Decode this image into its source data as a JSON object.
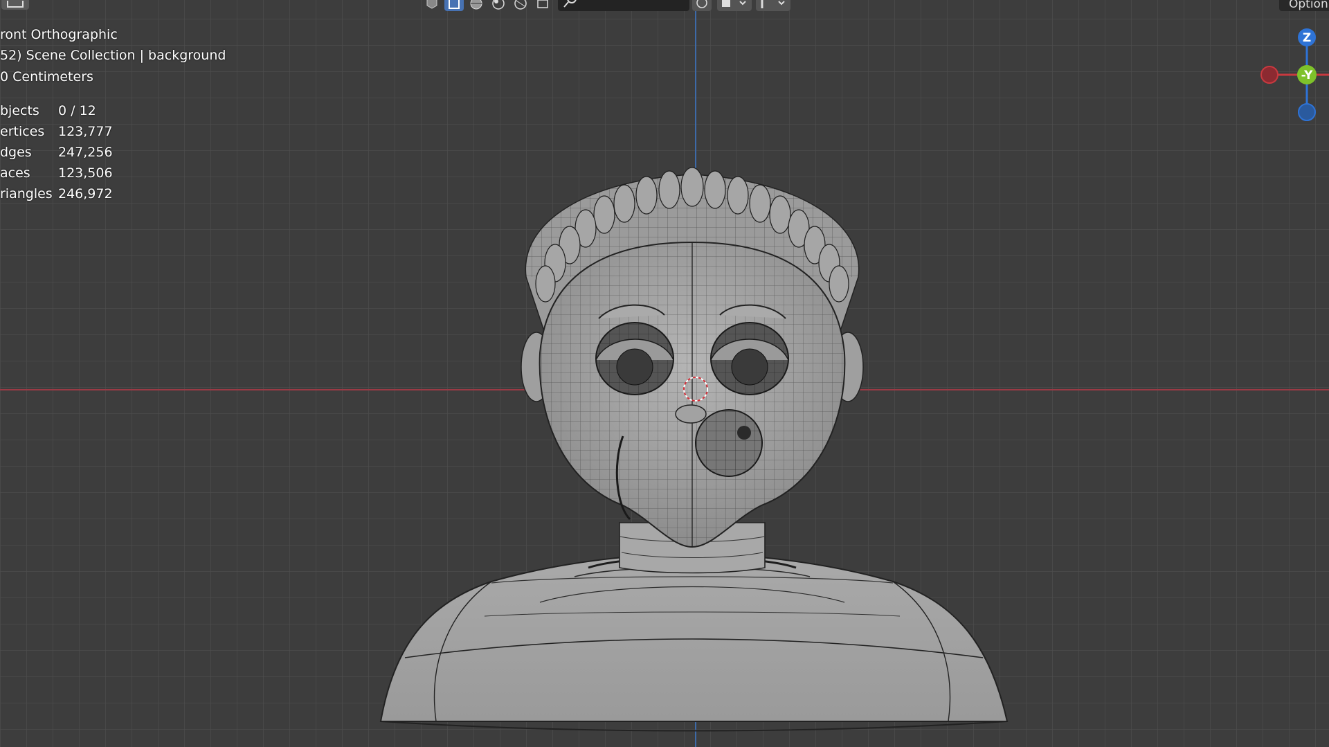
{
  "viewport": {
    "view_name": "ront Orthographic",
    "collection": "52) Scene Collection | background",
    "units": "0 Centimeters"
  },
  "stats": [
    {
      "label": "bjects",
      "value": "0 / 12"
    },
    {
      "label": "ertices",
      "value": "123,777"
    },
    {
      "label": "dges",
      "value": "247,256"
    },
    {
      "label": "aces",
      "value": "123,506"
    },
    {
      "label": "riangles",
      "value": "246,972"
    }
  ],
  "header": {
    "options_label": "Option",
    "icons": [
      "editor-type-icon",
      "wireframe-icon",
      "solid-icon",
      "material-preview-icon",
      "rendered-icon",
      "viewport-shading-icon",
      "overlay-icon",
      "search-icon",
      "xray-icon",
      "gizmo-toggle-icon",
      "visibility-icon"
    ]
  },
  "gizmo": {
    "z_label": "Z",
    "y_label": "-Y",
    "x_color": "#c8393f",
    "y_color": "#7ec22a",
    "z_color": "#2e73d6"
  },
  "colors": {
    "background": "#3d3d3d",
    "x_axis": "#9b3a45",
    "z_axis": "#3d6aa8",
    "selected_tool": "#4772b3"
  }
}
